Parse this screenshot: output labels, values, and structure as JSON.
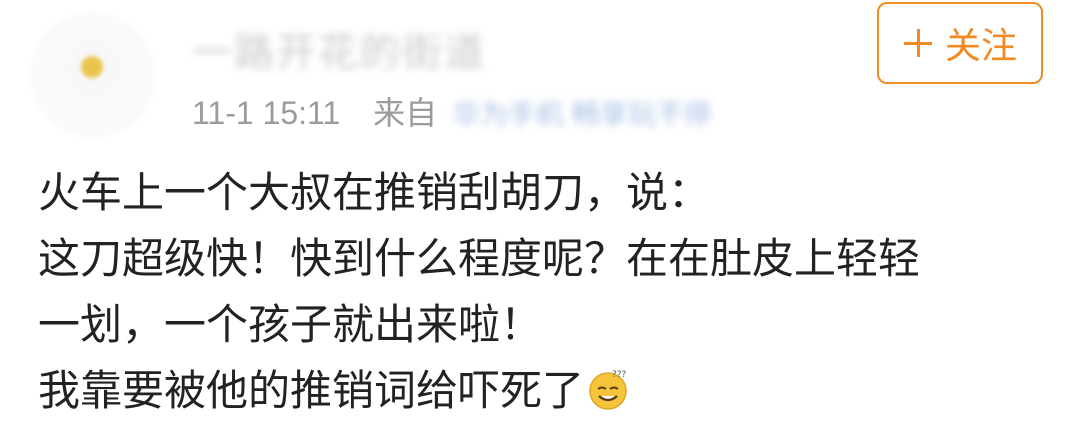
{
  "user": {
    "name": "一路开花的街道",
    "timestamp": "11-1 15:11",
    "source_prefix": "来自",
    "source": "华为手机 畅享玩不停"
  },
  "follow_button": {
    "label": "关注",
    "color": "#f08a24"
  },
  "post": {
    "lines": [
      "火车上一个大叔在推销刮胡刀，说：",
      "这刀超级快！快到什么程度呢？在在肚皮上轻轻",
      "一划，一个孩子就出来啦！",
      "我靠要被他的推销词给吓死了"
    ],
    "emoji": "sweat-smile-emoji"
  }
}
